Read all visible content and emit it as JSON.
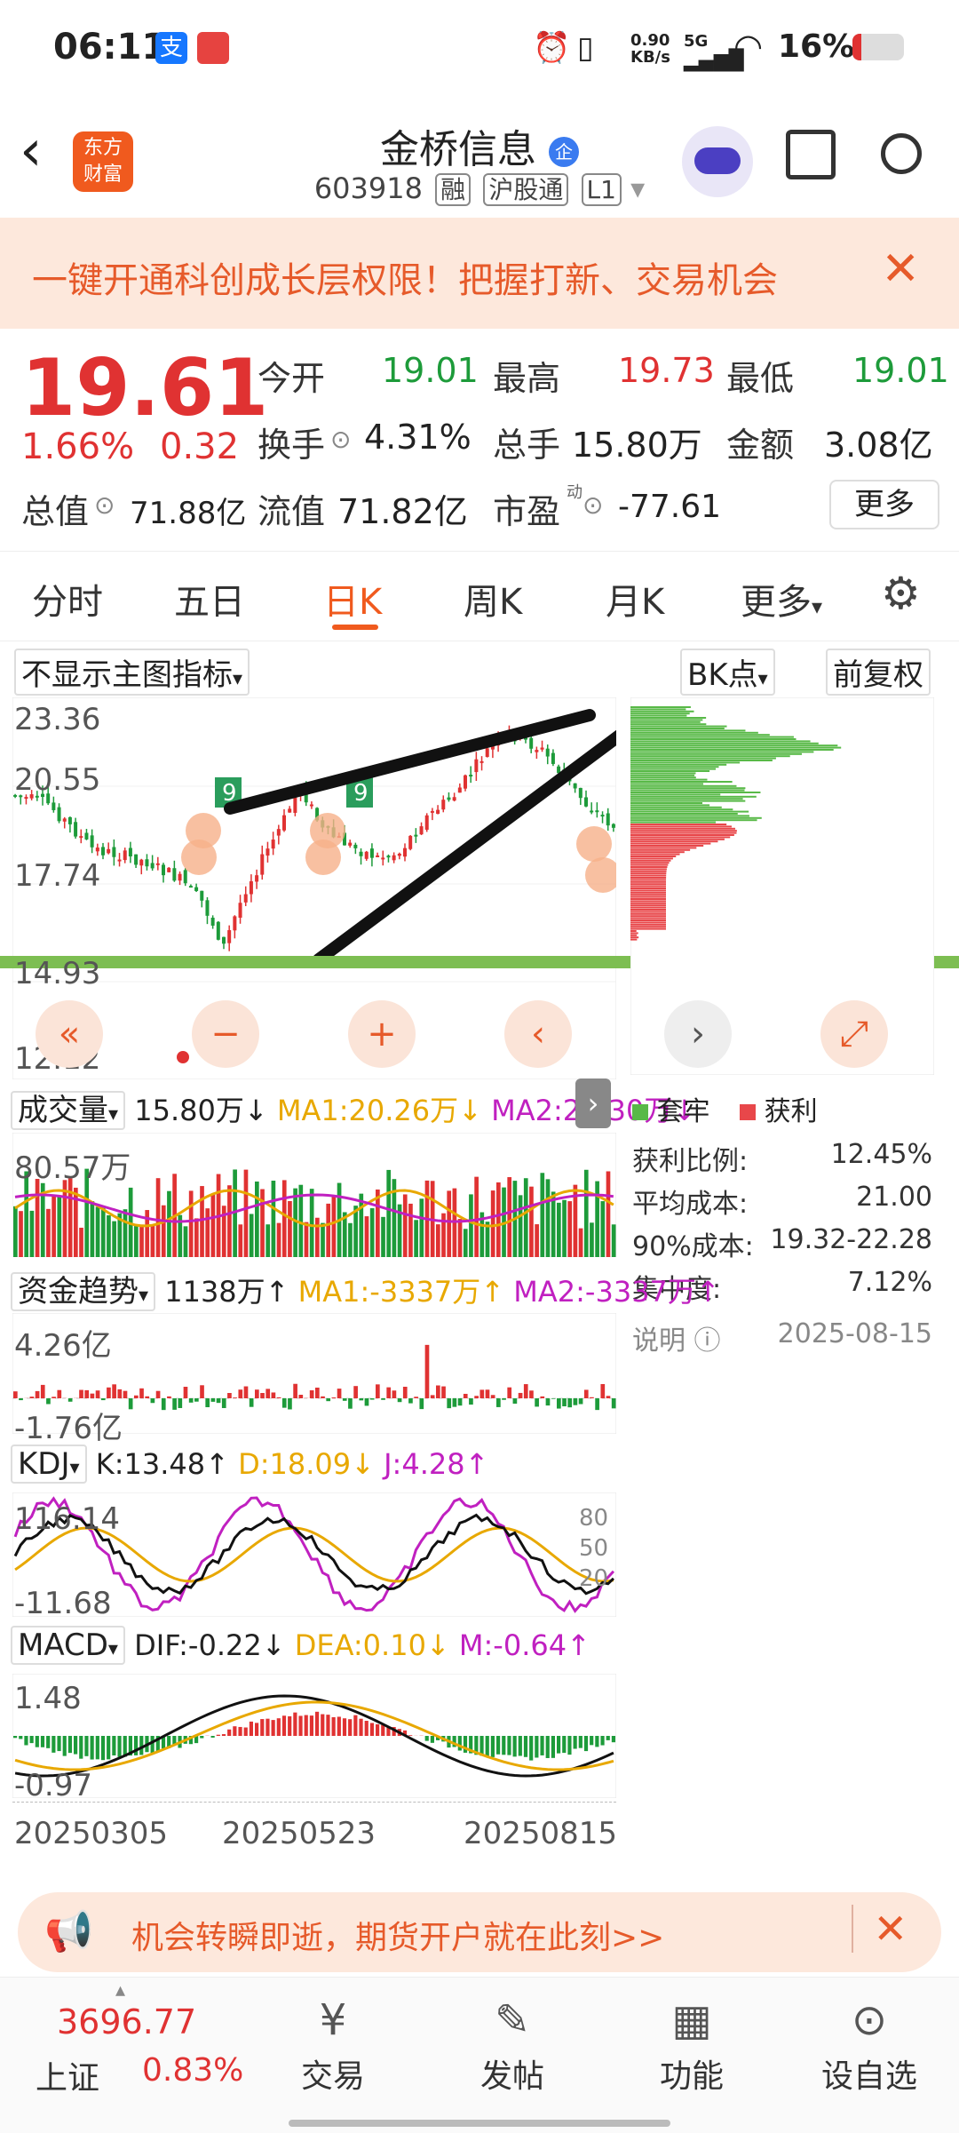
{
  "status_bar": {
    "time": "06:11",
    "net_speed": "0.90",
    "net_unit": "KB/s",
    "signal": "5G",
    "battery": "16%"
  },
  "header": {
    "stock_name": "金桥信息",
    "stock_code": "603918",
    "tags": [
      "融",
      "沪股通",
      "L1"
    ],
    "logo_line1": "东方",
    "logo_line2": "财富"
  },
  "banner": {
    "text": "一键开通科创成长层权限！把握打新、交易机会"
  },
  "quote": {
    "price": "19.61",
    "change_pct": "1.66%",
    "change": "0.32",
    "open_label": "今开",
    "open": "19.01",
    "high_label": "最高",
    "high": "19.73",
    "low_label": "最低",
    "low": "19.01",
    "turnover_label": "换手",
    "turnover": "4.31%",
    "volume_label": "总手",
    "volume": "15.80万",
    "amount_label": "金额",
    "amount": "3.08亿",
    "mktcap_label": "总值",
    "mktcap": "71.88亿",
    "float_label": "流值",
    "float": "71.82亿",
    "pe_label": "市盈",
    "pe_sup": "动",
    "pe": "-77.61",
    "more": "更多"
  },
  "tabs": [
    "分时",
    "五日",
    "日K",
    "周K",
    "月K",
    "更多"
  ],
  "active_tab": "日K",
  "chart": {
    "indicator_select": "不显示主图指标",
    "bk_select": "BK点",
    "adjust": "前复权",
    "price_ticks": [
      "23.36",
      "20.55",
      "17.74",
      "14.93",
      "12.12"
    ],
    "volume": {
      "label": "成交量",
      "value": "15.80万↓",
      "ma1": "MA1:20.26万↓",
      "ma2": "MA2:21.30万↓",
      "top": "80.57万"
    },
    "fund": {
      "label": "资金趋势",
      "value": "1138万↑",
      "ma1": "MA1:-3337万↑",
      "ma2": "MA2:-3337万↑",
      "top": "4.26亿",
      "bottom": "-1.76亿"
    },
    "kdj": {
      "label": "KDJ",
      "k": "K:13.48↑",
      "d": "D:18.09↓",
      "j": "J:4.28↑",
      "top": "116.14",
      "bottom": "-11.68",
      "levels": [
        "80",
        "50",
        "20"
      ]
    },
    "macd": {
      "label": "MACD",
      "dif": "DIF:-0.22↓",
      "dea": "DEA:0.10↓",
      "m": "M:-0.64↑",
      "top": "1.48",
      "bottom": "-0.97"
    },
    "dates": [
      "20250305",
      "20250523",
      "20250815"
    ]
  },
  "chips": {
    "legend_hold": "套牢",
    "legend_profit": "获利",
    "rows": [
      {
        "k": "获利比例:",
        "v": "12.45%"
      },
      {
        "k": "平均成本:",
        "v": "21.00"
      },
      {
        "k": "90%成本:",
        "v": "19.32-22.28"
      },
      {
        "k": "集中度:",
        "v": "7.12%"
      }
    ],
    "note": "说明",
    "date": "2025-08-15"
  },
  "promo": {
    "text": "机会转瞬即逝，期货开户就在此刻>>"
  },
  "bottom_nav": {
    "index_value": "3696.77",
    "index_name": "上证",
    "index_change": "0.83%",
    "items": [
      "交易",
      "发帖",
      "功能",
      "设自选"
    ]
  }
}
